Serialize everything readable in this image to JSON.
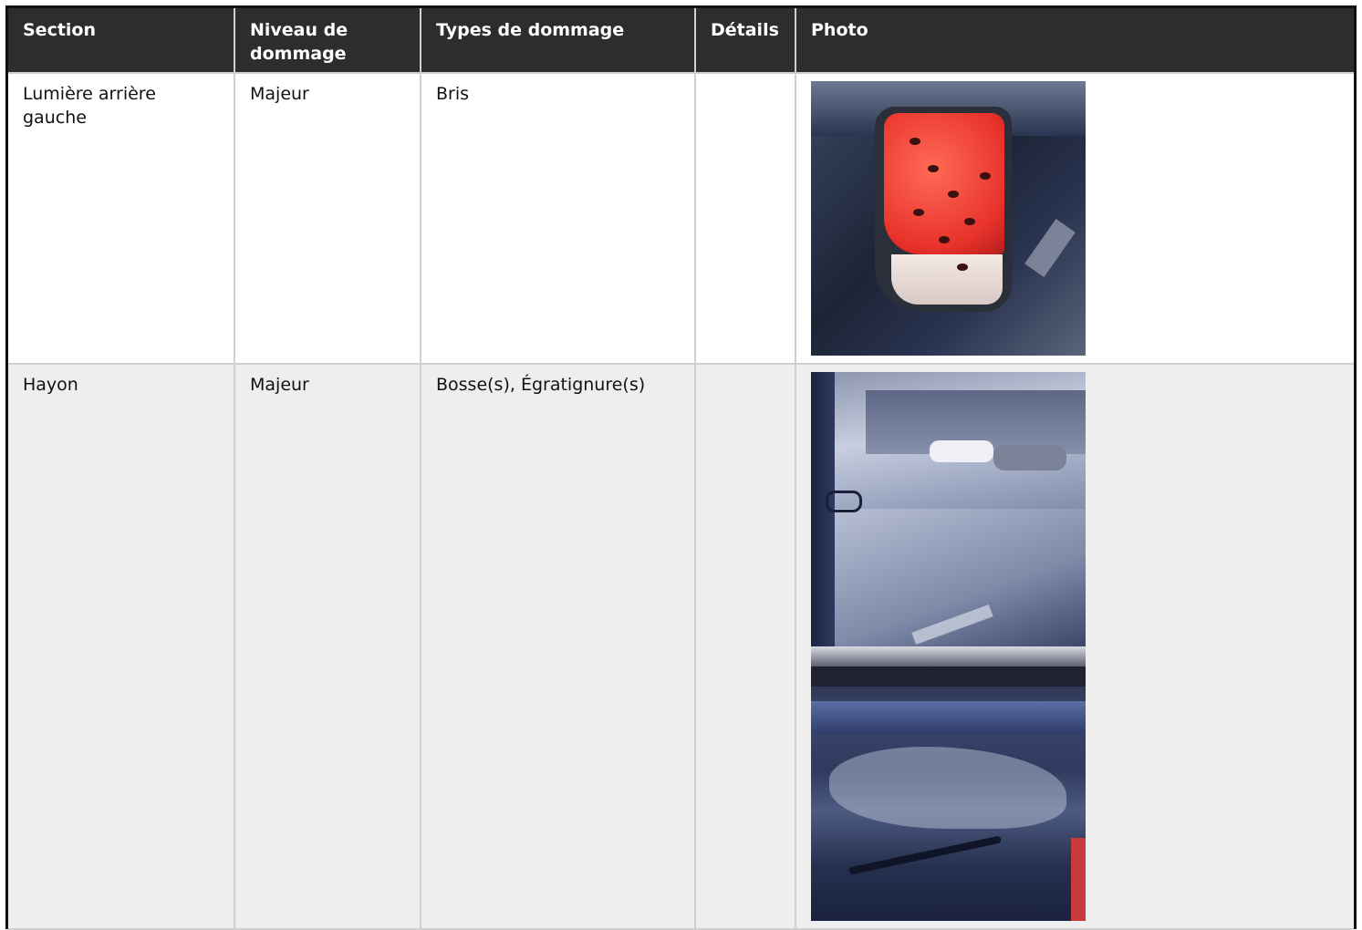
{
  "table": {
    "headers": {
      "section": "Section",
      "level": "Niveau de dommage",
      "types": "Types de dommage",
      "details": "Détails",
      "photo": "Photo"
    },
    "rows": [
      {
        "section": "Lumière arrière gauche",
        "level": "Majeur",
        "types": "Bris",
        "details": ""
      },
      {
        "section": "Hayon",
        "level": "Majeur",
        "types": "Bosse(s), Égratignure(s)",
        "details": ""
      }
    ]
  }
}
